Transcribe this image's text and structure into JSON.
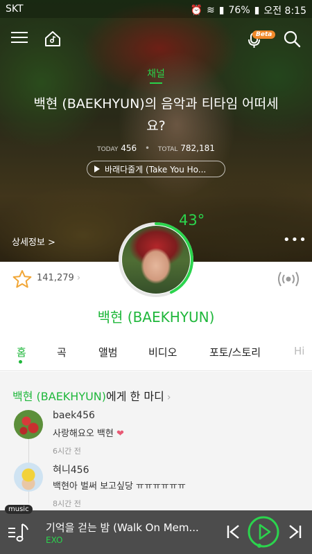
{
  "status": {
    "carrier": "SKT",
    "battery": "76%",
    "time": "오전 8:15"
  },
  "header": {
    "beta_badge": "Beta"
  },
  "channel": {
    "label": "채널",
    "title": "백현 (BAEKHYUN)의 음악과 티타임 어떠세요?",
    "today_label": "TODAY",
    "today_value": "456",
    "total_label": "TOTAL",
    "total_value": "782,181",
    "now_playing": "바래다줄게 (Take You Ho...",
    "detail_link": "상세정보 >",
    "temperature": "43°",
    "temperature_fill_fraction": 0.43
  },
  "artist": {
    "favorite_count": "141,279",
    "name": "백현 (BAEKHYUN)"
  },
  "tabs": [
    {
      "label": "홈",
      "active": true
    },
    {
      "label": "곡"
    },
    {
      "label": "앨범"
    },
    {
      "label": "비디오"
    },
    {
      "label": "포토/스토리"
    },
    {
      "label": "Hi"
    }
  ],
  "comments_section": {
    "title_highlight": "백현 (BAEKHYUN)",
    "title_rest": "에게 한 마디",
    "items": [
      {
        "user": "baek456",
        "text": "사랑해요오 백현",
        "time": "6시간 전"
      },
      {
        "user": "혀니456",
        "text": "백현아 벌써 보고싶당 ㅠㅠㅠㅠㅠㅠ",
        "time": "8시간 전"
      }
    ]
  },
  "player": {
    "badge": "music",
    "track": "기억을 걷는 밤 (Walk On Mem...",
    "artist": "EXO"
  },
  "colors": {
    "accent_green": "#1fb73b",
    "bright_green": "#2bd44d",
    "beta_orange": "#f08a2b",
    "player_bg": "#4c4c4c"
  }
}
